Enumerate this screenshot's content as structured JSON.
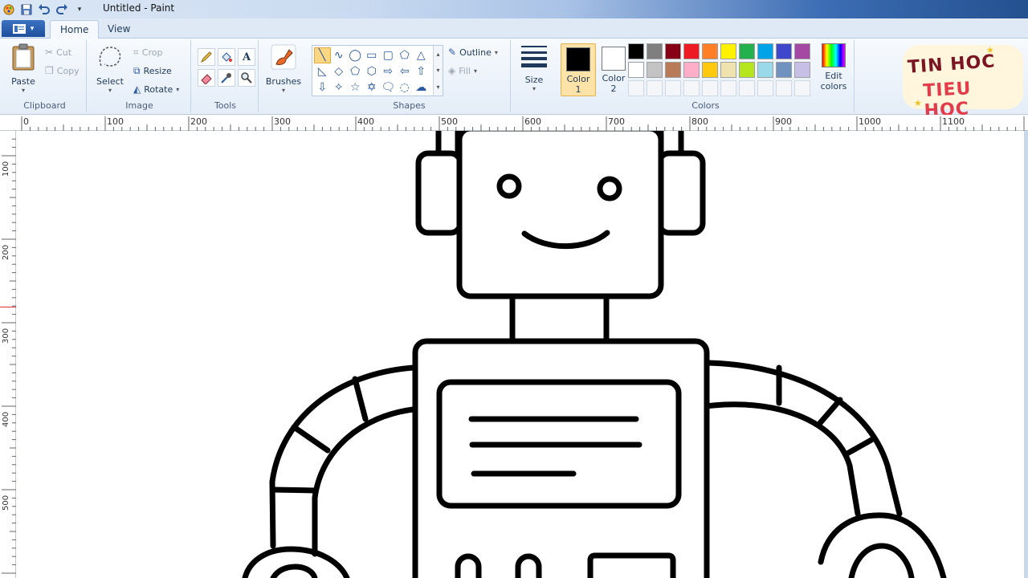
{
  "window": {
    "title": "Untitled - Paint"
  },
  "tabs": [
    {
      "label": "Home",
      "active": true
    },
    {
      "label": "View",
      "active": false
    }
  ],
  "ribbon": {
    "clipboard": {
      "label": "Clipboard",
      "paste": "Paste",
      "cut": "Cut",
      "copy": "Copy"
    },
    "image": {
      "label": "Image",
      "select": "Select",
      "crop": "Crop",
      "resize": "Resize",
      "rotate": "Rotate"
    },
    "tools": {
      "label": "Tools"
    },
    "brushes": {
      "label": "Brushes"
    },
    "shapes": {
      "label": "Shapes",
      "outline": "Outline",
      "fill": "Fill"
    },
    "size": {
      "label": "Size"
    },
    "colors": {
      "label": "Colors",
      "color1_label": "Color",
      "color1_num": "1",
      "color2_label": "Color",
      "color2_num": "2",
      "edit_line1": "Edit",
      "edit_line2": "colors",
      "color1": "#000000",
      "color2": "#ffffff",
      "palette_row1": [
        "#000000",
        "#7f7f7f",
        "#880015",
        "#ed1c24",
        "#ff7f27",
        "#fff200",
        "#22b14c",
        "#00a2e8",
        "#3f48cc",
        "#a349a4"
      ],
      "palette_row2": [
        "#ffffff",
        "#c3c3c3",
        "#b97a57",
        "#ffaec9",
        "#ffc90e",
        "#efe4b0",
        "#b5e61d",
        "#99d9ea",
        "#7092be",
        "#c8bfe7"
      ]
    }
  },
  "logo": {
    "line1": "TIN HOC",
    "line2": "TIEU HOC"
  },
  "ruler": {
    "horizontal": [
      "0",
      "100",
      "200",
      "300",
      "400",
      "500",
      "600",
      "700",
      "800",
      "900",
      "1000",
      "1100"
    ],
    "vertical": [
      "100",
      "200",
      "300",
      "400",
      "500"
    ]
  }
}
